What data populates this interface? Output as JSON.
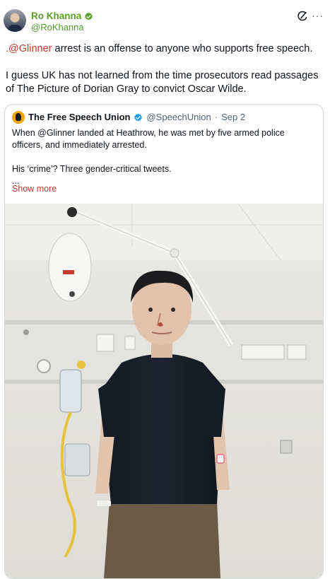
{
  "author": {
    "name": "Ro Khanna",
    "handle": "@RoKhanna",
    "verified_color": "#5c9e2a"
  },
  "tweet": {
    "mention": ".@Glinner",
    "line1_rest": " arrest is an offense to anyone who supports free speech.",
    "para2": "I guess UK has not learned from the time prosecutors read passages of The Picture of Dorian Gray to convict Oscar Wilde."
  },
  "quote": {
    "name": "The Free Speech Union",
    "handle": "@SpeechUnion",
    "separator": "·",
    "date": "Sep 2",
    "text1": "When @Glinner landed at Heathrow, he was met by five armed police officers, and immediately arrested.",
    "text2": "His ‘crime’? Three gender-critical tweets.",
    "ellipsis": "...",
    "show_more": "Show more"
  },
  "colors": {
    "accent": "#c0392b",
    "border": "#cfd9de",
    "muted": "#536471"
  },
  "icons": [
    "avatar",
    "verified-badge-icon",
    "grok-icon",
    "more-options-icon",
    "verified-badge-icon"
  ]
}
